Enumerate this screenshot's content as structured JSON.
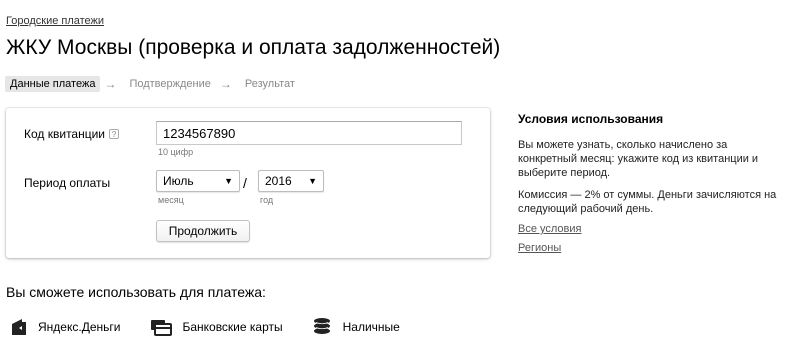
{
  "breadcrumb": "Городские платежи",
  "title": "ЖКУ Москвы (проверка и оплата задолженностей)",
  "steps": [
    {
      "label": "Данные платежа",
      "active": true
    },
    {
      "label": "Подтверждение",
      "active": false
    },
    {
      "label": "Результат",
      "active": false
    }
  ],
  "step_arrow": "→",
  "form": {
    "code_label": "Код квитанции",
    "help_icon": "?",
    "code_value": "1234567890",
    "code_hint": "10 цифр",
    "period_label": "Период оплаты",
    "month_value": "Июль",
    "month_hint": "месяц",
    "separator": "/",
    "year_value": "2016",
    "year_hint": "год",
    "submit_label": "Продолжить"
  },
  "sidebar": {
    "title": "Условия использования",
    "text1": "Вы можете узнать, сколько начислено за конкретный месяц: укажите код из квитанции и выберите период.",
    "text2": "Комиссия — 2% от суммы. Деньги зачисляются на следующий рабочий день.",
    "links": [
      "Все условия",
      "Регионы"
    ]
  },
  "payment": {
    "title": "Вы сможете использовать для платежа:",
    "methods": [
      {
        "label": "Яндекс.Деньги",
        "icon": "yandex-money-icon"
      },
      {
        "label": "Банковские карты",
        "icon": "bank-card-icon"
      },
      {
        "label": "Наличные",
        "icon": "cash-coins-icon"
      }
    ]
  }
}
